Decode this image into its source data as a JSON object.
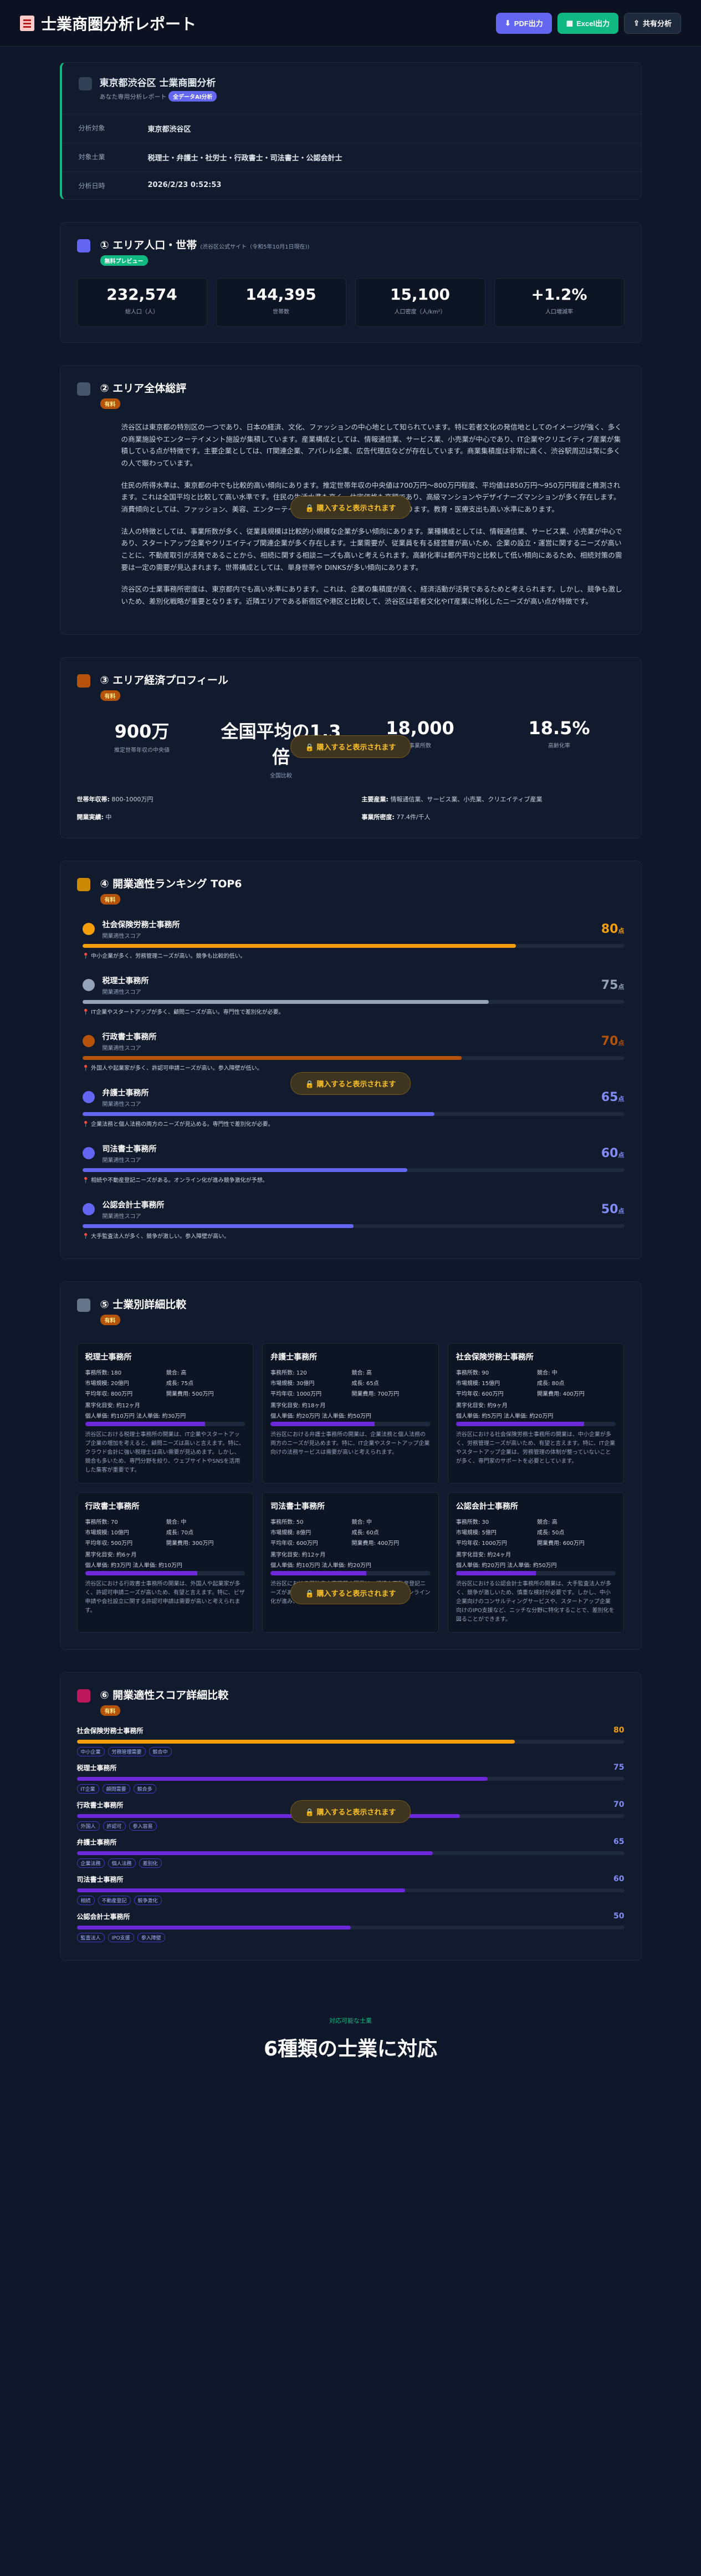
{
  "header": {
    "title": "士業商圏分析レポート",
    "pdf": "PDF出力",
    "excel": "Excel出力",
    "share": "共有分析"
  },
  "info": {
    "title": "東京都渋谷区 士業商圏分析",
    "sub": "あなた専用分析レポート",
    "tag": "全データAI分析",
    "rows": [
      {
        "label": "分析対象",
        "value": "東京都渋谷区"
      },
      {
        "label": "対象士業",
        "value": "税理士・弁護士・社労士・行政書士・司法書士・公認会計士"
      },
      {
        "label": "分析日時",
        "value": "2026/2/23 0:52:53"
      }
    ]
  },
  "s1": {
    "title": "① エリア人口・世帯",
    "sub": "(渋谷区公式サイト（令和5年10月1日現在))",
    "badge": "無料プレビュー",
    "stats": [
      {
        "num": "232,574",
        "label": "総人口（人）"
      },
      {
        "num": "144,395",
        "label": "世帯数"
      },
      {
        "num": "15,100",
        "label": "人口密度（人/km²）"
      },
      {
        "num": "+1.2%",
        "label": "人口増減率"
      }
    ]
  },
  "s2": {
    "title": "② エリア全体総評",
    "badge": "有料",
    "lock": "購入すると表示されます",
    "paras": [
      "渋谷区は東京都の特別区の一つであり、日本の経済、文化、ファッションの中心地として知られています。特に若者文化の発信地としてのイメージが強く、多くの商業施設やエンターテイメント施設が集積しています。産業構成としては、情報通信業、サービス業、小売業が中心であり、IT企業やクリエイティブ産業が集積している点が特徴です。主要企業としては、IT関連企業、アパレル企業、広告代理店などが存在しています。商業集積度は非常に高く、渋谷駅周辺は常に多くの人で賑わっています。",
      "住民の所得水準は、東京都の中でも比較的高い傾向にあります。推定世帯年収の中央値は700万円〜800万円程度、平均値は850万円〜950万円程度と推測されます。これは全国平均と比較して高い水準です。住民の生活水準も高く、住宅価格も高額であり、高級マンションやデザイナーズマンションが多く存在します。消費傾向としては、ファッション、美容、エンターテイメントに対する支出が高い傾向にあります。教育・医療支出も高い水準にあります。",
      "法人の特徴としては、事業所数が多く、従業員規模は比較的小規模な企業が多い傾向にあります。業種構成としては、情報通信業、サービス業、小売業が中心であり、スタートアップ企業やクリエイティブ関連企業が多く存在します。士業需要が、従業員を有る経営層が高いため、企業の設立・運営に関するニーズが高いことに、不動産取引が活発であることから、相続に関する相談ニーズも高いと考えられます。高齢化率は都内平均と比較して低い傾向にあるため、相続対策の需要は一定の需要が見込まれます。世帯構成としては、単身世帯や DINKSが多い傾向にあります。",
      "渋谷区の士業事務所密度は、東京都内でも高い水準にあります。これは、企業の集積度が高く、経済活動が活発であるためと考えられます。しかし、競争も激しいため、差別化戦略が重要となります。近隣エリアである新宿区や港区と比較して、渋谷区は若者文化やIT産業に特化したニーズが高い点が特徴です。"
    ]
  },
  "s3": {
    "title": "③ エリア経済プロフィール",
    "badge": "有料",
    "lock": "購入すると表示されます",
    "stats": [
      {
        "num": "900万",
        "label": "推定世帯年収の中央値"
      },
      {
        "num": "全国平均の1.3倍",
        "label": "全国比較"
      },
      {
        "num": "18,000",
        "label": "事業所数"
      },
      {
        "num": "18.5%",
        "label": "高齢化率"
      }
    ],
    "rows": [
      {
        "label": "世帯年収帯:",
        "value": "800-1000万円"
      },
      {
        "label": "主要産業:",
        "value": "情報通信業、サービス業、小売業、クリエイティブ産業"
      },
      {
        "label": "開業実績:",
        "value": "中"
      },
      {
        "label": "事業所密度:",
        "value": "77.4件/千人"
      }
    ]
  },
  "s4": {
    "title": "④ 開業適性ランキング TOP6",
    "badge": "有料",
    "lock": "購入すると表示されます",
    "items": [
      {
        "name": "社会保険労務士事務所",
        "sub": "開業適性スコア",
        "score": "80",
        "unit": "点",
        "pct": 80,
        "color": "#f59e0b",
        "note": "中小企業が多く、労務管理ニーズが高い。競争も比較的低い。"
      },
      {
        "name": "税理士事務所",
        "sub": "開業適性スコア",
        "score": "75",
        "unit": "点",
        "pct": 75,
        "color": "#94a3b8",
        "note": "IT企業やスタートアップが多く、顧問ニーズが高い。専門性で差別化が必要。"
      },
      {
        "name": "行政書士事務所",
        "sub": "開業適性スコア",
        "score": "70",
        "unit": "点",
        "pct": 70,
        "color": "#b45309",
        "note": "外国人や起業家が多く、許認可申請ニーズが高い。参入障壁が低い。"
      },
      {
        "name": "弁護士事務所",
        "sub": "開業適性スコア",
        "score": "65",
        "unit": "点",
        "pct": 65,
        "color": "#6366f1",
        "note": "企業法務と個人法務の両方のニーズが見込める。専門性で差別化が必要。"
      },
      {
        "name": "司法書士事務所",
        "sub": "開業適性スコア",
        "score": "60",
        "unit": "点",
        "pct": 60,
        "color": "#6366f1",
        "note": "相続や不動産登記ニーズがある。オンライン化が進み競争激化が予想。"
      },
      {
        "name": "公認会計士事務所",
        "sub": "開業適性スコア",
        "score": "50",
        "unit": "点",
        "pct": 50,
        "color": "#6366f1",
        "note": "大手監査法人が多く、競争が激しい。参入障壁が高い。"
      }
    ]
  },
  "s5": {
    "title": "⑤ 士業別詳細比較",
    "badge": "有料",
    "lock": "購入すると表示されます",
    "cards": [
      {
        "name": "税理士事務所",
        "a": "事務所数: 180",
        "b": "競合: 高",
        "c": "市場規模: 20億円",
        "d": "成長: 75点",
        "e": "平均年収: 800万円",
        "f": "開業費用: 500万円",
        "g": "黒字化目安: 約12ヶ月",
        "h": "個人単価: 約10万円  法人単価: 約30万円",
        "pct": 75,
        "body": "渋谷区における税理士事務所の開業は、IT企業やスタートアップ企業の増加を考えると、顧問ニーズは高いと言えます。特に、クラウド会計に強い税理士は高い需要が見込めます。しかし、競合も多いため、専門分野を絞り、ウェブサイトやSNSを活用した集客が重要です。"
      },
      {
        "name": "弁護士事務所",
        "a": "事務所数: 120",
        "b": "競合: 高",
        "c": "市場規模: 30億円",
        "d": "成長: 65点",
        "e": "平均年収: 1000万円",
        "f": "開業費用: 700万円",
        "g": "黒字化目安: 約18ヶ月",
        "h": "個人単価: 約20万円  法人単価: 約50万円",
        "pct": 65,
        "body": "渋谷区における弁護士事務所の開業は、企業法務と個人法務の両方のニーズが見込めます。特に、IT企業やスタートアップ企業向けの法務サービスは需要が高いと考えられます。"
      },
      {
        "name": "社会保険労務士事務所",
        "a": "事務所数: 90",
        "b": "競合: 中",
        "c": "市場規模: 15億円",
        "d": "成長: 80点",
        "e": "平均年収: 600万円",
        "f": "開業費用: 400万円",
        "g": "黒字化目安: 約9ヶ月",
        "h": "個人単価: 約5万円  法人単価: 約20万円",
        "pct": 80,
        "body": "渋谷区における社会保険労務士事務所の開業は、中小企業が多く、労務管理ニーズが高いため、有望と言えます。特に、IT企業やスタートアップ企業は、労務管理の体制が整っていないことが多く、専門家のサポートを必要としています。"
      },
      {
        "name": "行政書士事務所",
        "a": "事務所数: 70",
        "b": "競合: 中",
        "c": "市場規模: 10億円",
        "d": "成長: 70点",
        "e": "平均年収: 500万円",
        "f": "開業費用: 300万円",
        "g": "黒字化目安: 約6ヶ月",
        "h": "個人単価: 約3万円  法人単価: 約10万円",
        "pct": 70,
        "body": "渋谷区における行政書士事務所の開業は、外国人や起業家が多く、許認可申請ニーズが高いため、有望と言えます。特に、ビザ申請や会社設立に関する許認可申請は需要が高いと考えられます。"
      },
      {
        "name": "司法書士事務所",
        "a": "事務所数: 50",
        "b": "競合: 中",
        "c": "市場規模: 8億円",
        "d": "成長: 60点",
        "e": "平均年収: 600万円",
        "f": "開業費用: 400万円",
        "g": "黒字化目安: 約12ヶ月",
        "h": "個人単価: 約10万円  法人単価: 約20万円",
        "pct": 60,
        "body": "渋谷区における司法書士事務所の開業は、相続や不動産登記ニーズがあるため、一定の需要が見込めます。しかし、オンライン化が進み、競争激化が予想されます。"
      },
      {
        "name": "公認会計士事務所",
        "a": "事務所数: 30",
        "b": "競合: 高",
        "c": "市場規模: 5億円",
        "d": "成長: 50点",
        "e": "平均年収: 1000万円",
        "f": "開業費用: 600万円",
        "g": "黒字化目安: 約24ヶ月",
        "h": "個人単価: 約20万円  法人単価: 約50万円",
        "pct": 50,
        "body": "渋谷区における公認会計士事務所の開業は、大手監査法人が多く、競争が激しいため、慎重な検討が必要です。しかし、中小企業向けのコンサルティングサービスや、スタートアップ企業向けのIPO支援など、ニッチな分野に特化することで、差別化を図ることができます。"
      }
    ]
  },
  "s6": {
    "title": "⑥ 開業適性スコア詳細比較",
    "badge": "有料",
    "lock": "購入すると表示されます",
    "items": [
      {
        "name": "社会保険労務士事務所",
        "score": "80",
        "pct": 80,
        "color": "#f59e0b",
        "tags": [
          "中小企業",
          "労務管理需要",
          "競合中"
        ]
      },
      {
        "name": "税理士事務所",
        "score": "75",
        "pct": 75,
        "color": "#6d28d9",
        "tags": [
          "IT企業",
          "顧問需要",
          "競合多"
        ]
      },
      {
        "name": "行政書士事務所",
        "score": "70",
        "pct": 70,
        "color": "#6d28d9",
        "tags": [
          "外国人",
          "許認可",
          "参入容易"
        ]
      },
      {
        "name": "弁護士事務所",
        "score": "65",
        "pct": 65,
        "color": "#6d28d9",
        "tags": [
          "企業法務",
          "個人法務",
          "差別化"
        ]
      },
      {
        "name": "司法書士事務所",
        "score": "60",
        "pct": 60,
        "color": "#6d28d9",
        "tags": [
          "相続",
          "不動産登記",
          "競争激化"
        ]
      },
      {
        "name": "公認会計士事務所",
        "score": "50",
        "pct": 50,
        "color": "#6d28d9",
        "tags": [
          "監査法人",
          "IPO支援",
          "参入障壁"
        ]
      }
    ]
  },
  "footer": {
    "small": "対応可能な士業",
    "big": "6種類の士業に対応"
  }
}
